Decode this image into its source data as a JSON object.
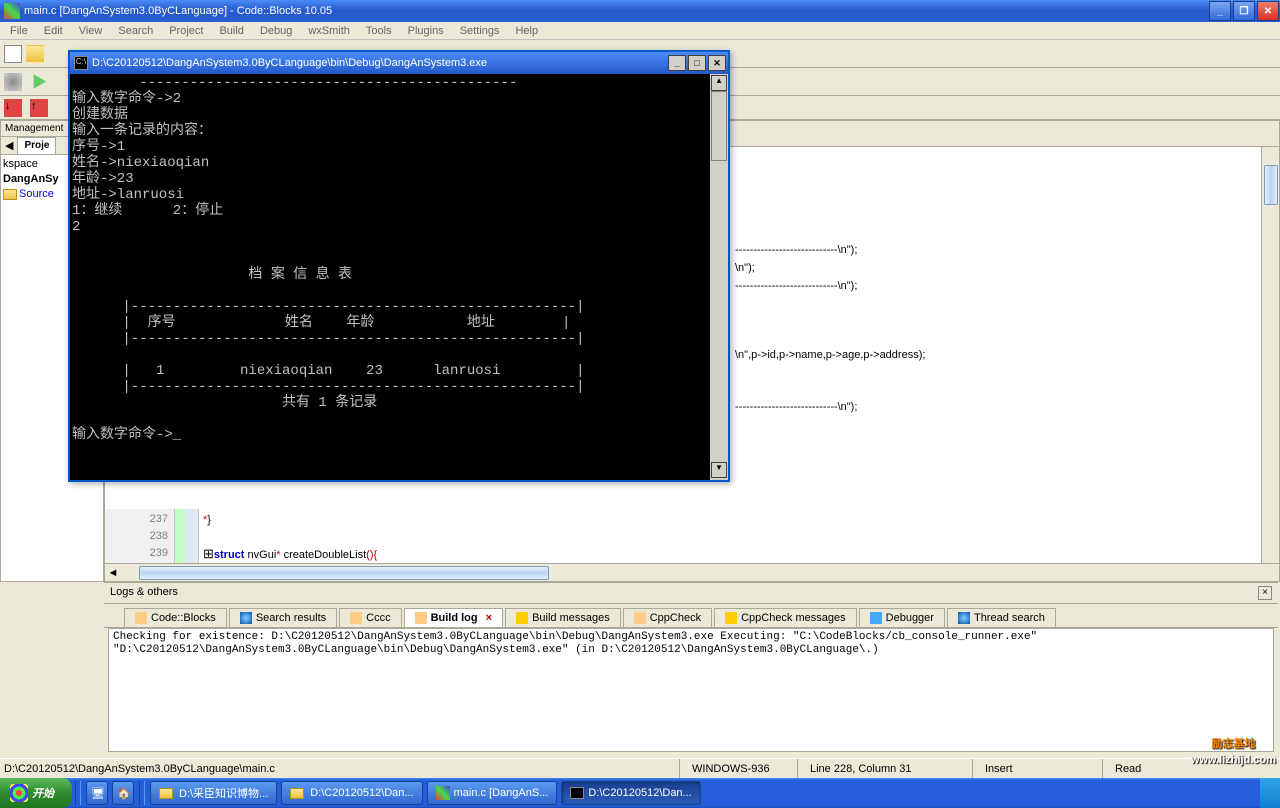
{
  "window": {
    "title": "main.c [DangAnSystem3.0ByCLanguage] - Code::Blocks 10.05"
  },
  "menu": {
    "items": [
      "File",
      "Edit",
      "View",
      "Search",
      "Project",
      "Build",
      "Debug",
      "wxSmith",
      "Tools",
      "Plugins",
      "Settings",
      "Help"
    ]
  },
  "sidebar": {
    "header": "Management",
    "tab": "Proje",
    "tree": [
      "kspace",
      "DangAnSy",
      "Source"
    ]
  },
  "editor": {
    "lines": [
      "237",
      "238",
      "239"
    ],
    "code237_open": "*",
    "code237_close": "}",
    "code239_kw": "struct",
    "code239_a": " nvGui",
    "code239_op1": "*",
    "code239_b": " createDoubleList",
    "code239_op2": "(){",
    "frag_str1": "----------------------------\\n\"",
    "frag_cl1": ");",
    "frag_str2": "\\n\"",
    "frag_cl2": ");",
    "frag_str3": "----------------------------\\n\"",
    "frag_cl3": ");",
    "frag_str4": "\\n\"",
    "frag_mid": ",p->id,p->name,p->age,p->address);",
    "frag_str5": "----------------------------\\n\"",
    "frag_cl5": ");"
  },
  "logs": {
    "header": "Logs & others",
    "tabs": [
      "Code::Blocks",
      "Search results",
      "Cccc",
      "Build log",
      "Build messages",
      "CppCheck",
      "CppCheck messages",
      "Debugger",
      "Thread search"
    ],
    "active": 3,
    "content": "Checking for existence: D:\\C20120512\\DangAnSystem3.0ByCLanguage\\bin\\Debug\\DangAnSystem3.exe\nExecuting: \"C:\\CodeBlocks/cb_console_runner.exe\" \"D:\\C20120512\\DangAnSystem3.0ByCLanguage\\bin\\Debug\\DangAnSystem3.exe\"  (in D:\\C20120512\\DangAnSystem3.0ByCLanguage\\.)"
  },
  "status": {
    "path": "D:\\C20120512\\DangAnSystem3.0ByCLanguage\\main.c",
    "encoding": "WINDOWS-936",
    "position": "Line 228, Column 31",
    "mode": "Insert",
    "readonly": "Read"
  },
  "taskbar": {
    "start": "开始",
    "tasks": [
      "D:\\采臣知识博物...",
      "D:\\C20120512\\Dan...",
      "main.c [DangAnS...",
      "D:\\C20120512\\Dan..."
    ],
    "active": 3
  },
  "console": {
    "title": "D:\\C20120512\\DangAnSystem3.0ByCLanguage\\bin\\Debug\\DangAnSystem3.exe",
    "text": "        ---------------------------------------------\n输入数字命令->2\n创建数据\n输入一条记录的内容：\n序号->1\n姓名->niexiaoqian\n年龄->23\n地址->lanruosi\n1：继续      2：停止\n2\n\n\n                     档 案 信 息 表\n\n      |-----------------------------------------------------|\n      |  序号             姓名    年龄           地址        |\n      |-----------------------------------------------------|\n\n      |   1         niexiaoqian    23      lanruosi         |\n      |-----------------------------------------------------|\n                         共有 1 条记录\n\n输入数字命令->_"
  },
  "watermark": {
    "line1": "励志基地",
    "url": "www.lizhijd.com"
  }
}
